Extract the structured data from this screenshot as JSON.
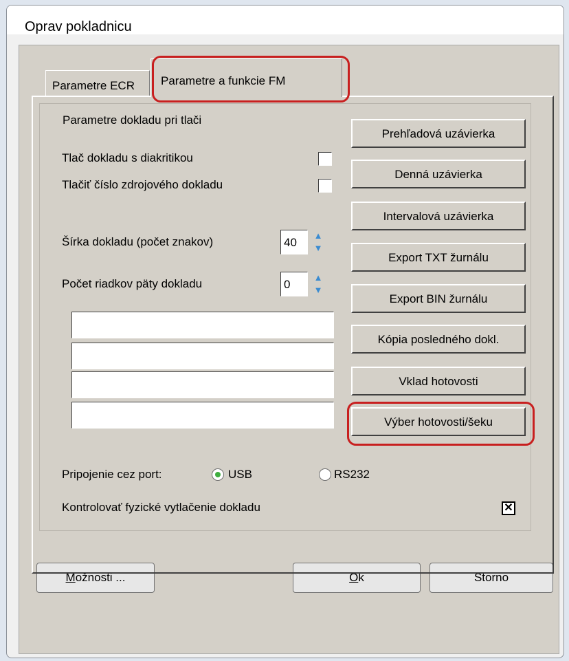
{
  "window": {
    "title": "Oprav pokladnicu"
  },
  "tabs": [
    {
      "label": "Parametre ECR"
    },
    {
      "label": "Parametre a funkcie FM"
    }
  ],
  "group": {
    "title": "Parametre dokladu pri tlači"
  },
  "options": {
    "diacritics_label": "Tlač dokladu s diakritikou",
    "source_number_label": "Tlačiť číslo zdrojového dokladu",
    "width_label": "Šírka dokladu (počet znakov)",
    "width_value": "40",
    "footer_rows_label": "Počet riadkov päty dokladu",
    "footer_rows_value": "0"
  },
  "buttons": [
    {
      "label": "Prehľadová uzávierka"
    },
    {
      "label": "Denná uzávierka"
    },
    {
      "label": "Intervalová uzávierka"
    },
    {
      "label": "Export TXT žurnálu"
    },
    {
      "label": "Export BIN žurnálu"
    },
    {
      "label": "Kópia posledného dokl."
    },
    {
      "label": "Vklad hotovosti"
    },
    {
      "label": "Výber hotovosti/šeku"
    }
  ],
  "connection": {
    "label": "Pripojenie cez port:",
    "usb_label": "USB",
    "rs232_label": "RS232",
    "selected": "USB"
  },
  "physical_check": {
    "label": "Kontrolovať fyzické vytlačenie dokladu",
    "checked": true
  },
  "footer": {
    "options_first": "M",
    "options_rest": "ožnosti ...",
    "ok_first": "O",
    "ok_rest": "k",
    "cancel_label": "Storno"
  },
  "colors": {
    "highlight": "#c81f1f",
    "radio_dot": "#3fae3f",
    "spin_arrow": "#3a8bd1"
  },
  "icons": {
    "spin_up": "chevron-up-icon",
    "spin_down": "chevron-down-icon",
    "check": "x-mark-icon"
  }
}
